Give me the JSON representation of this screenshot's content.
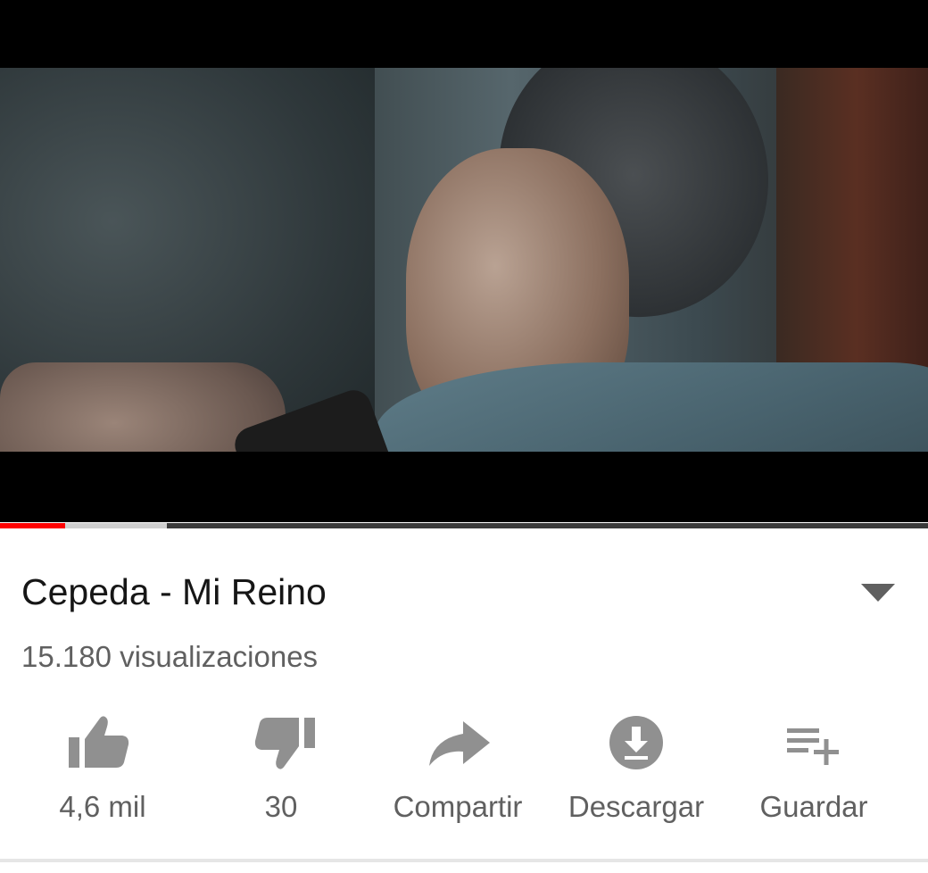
{
  "video": {
    "progress": {
      "played_fraction": 0.07,
      "buffered_fraction": 0.18
    }
  },
  "title": "Cepeda - Mi Reino",
  "views": "15.180 visualizaciones",
  "expand_icon": "chevron-down-icon",
  "actions": [
    {
      "icon": "thumb-up-icon",
      "label": "4,6 mil"
    },
    {
      "icon": "thumb-down-icon",
      "label": "30"
    },
    {
      "icon": "share-icon",
      "label": "Compartir"
    },
    {
      "icon": "download-icon",
      "label": "Descargar"
    },
    {
      "icon": "playlist-add-icon",
      "label": "Guardar"
    }
  ],
  "colors": {
    "progress_played": "#ff0000",
    "icon": "#909090",
    "title": "#161616",
    "secondary": "#606060"
  }
}
